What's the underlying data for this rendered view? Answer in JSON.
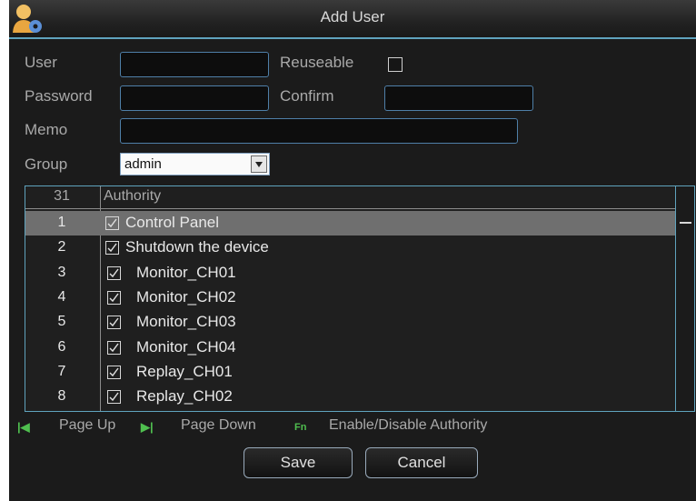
{
  "dialog": {
    "title": "Add User"
  },
  "form": {
    "user_label": "User",
    "user_value": "",
    "reuseable_label": "Reuseable",
    "reuseable_checked": false,
    "password_label": "Password",
    "confirm_label": "Confirm",
    "memo_label": "Memo",
    "group_label": "Group",
    "group_value": "admin"
  },
  "authority": {
    "count_header": "31",
    "name_header": "Authority",
    "rows": [
      {
        "num": "1",
        "name": "Control Panel",
        "checked": true,
        "selected": true
      },
      {
        "num": "2",
        "name": "Shutdown the device",
        "checked": true
      },
      {
        "num": "3",
        "name": "Monitor_CH01",
        "checked": true
      },
      {
        "num": "4",
        "name": "Monitor_CH02",
        "checked": true
      },
      {
        "num": "5",
        "name": "Monitor_CH03",
        "checked": true
      },
      {
        "num": "6",
        "name": "Monitor_CH04",
        "checked": true
      },
      {
        "num": "7",
        "name": "Replay_CH01",
        "checked": true
      },
      {
        "num": "8",
        "name": "Replay_CH02",
        "checked": true
      }
    ]
  },
  "hints": {
    "page_up": "Page Up",
    "page_down": "Page Down",
    "fn_label": "Fn",
    "enable_disable": "Enable/Disable Authority"
  },
  "buttons": {
    "save": "Save",
    "cancel": "Cancel"
  }
}
